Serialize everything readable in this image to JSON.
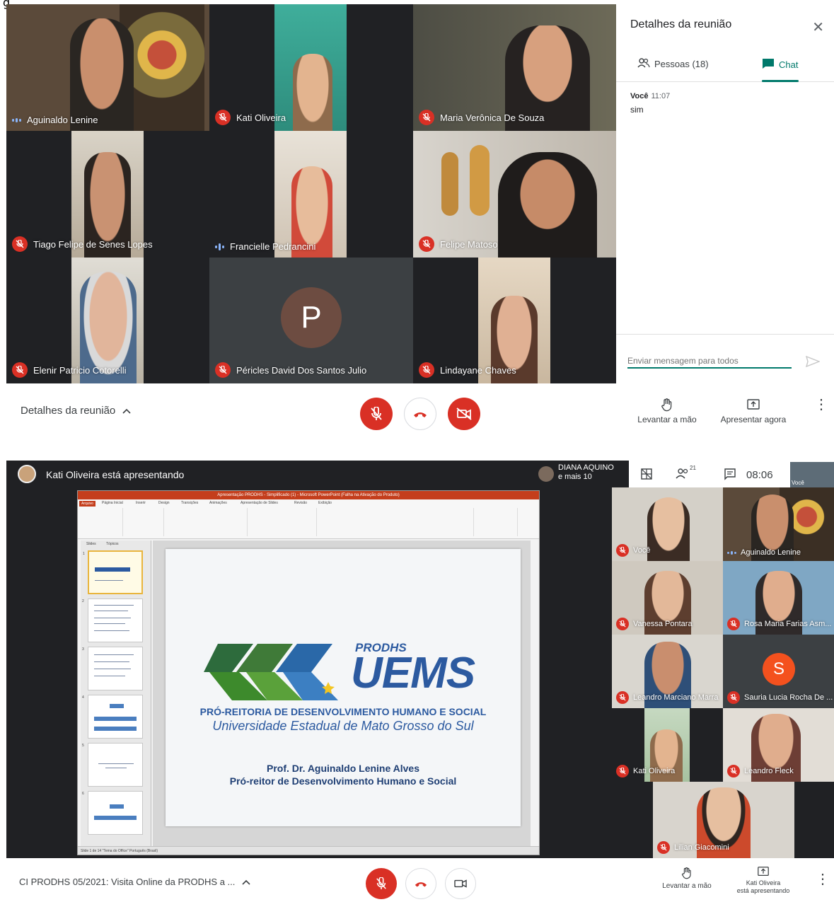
{
  "figure_label": "g",
  "meeting1": {
    "tiles": [
      {
        "name": "Aguinaldo Lenine",
        "status": "speaking"
      },
      {
        "name": "Kati Oliveira",
        "status": "muted"
      },
      {
        "name": "Maria Verônica De Souza",
        "status": "muted"
      },
      {
        "name": "Tiago Felipe de Senes Lopes",
        "status": "muted"
      },
      {
        "name": "Francielle Pedrancini",
        "status": "speaking"
      },
      {
        "name": "Felipe Matoso",
        "status": "muted"
      },
      {
        "name": "Elenir Patricio Cotorelli",
        "status": "muted"
      },
      {
        "name": "Péricles David Dos Santos Julio",
        "status": "muted",
        "avatar_letter": "P"
      },
      {
        "name": "Lindayane Chaves",
        "status": "muted"
      }
    ],
    "panel": {
      "title": "Detalhes da reunião",
      "tab_people": "Pessoas (18)",
      "tab_chat": "Chat",
      "message": {
        "author": "Você",
        "time": "11:07",
        "text": "sim"
      },
      "input_placeholder": "Enviar mensagem para todos"
    },
    "bottom": {
      "details_label": "Detalhes da reunião",
      "raise_hand": "Levantar a mão",
      "present_now": "Apresentar agora"
    },
    "colors": {
      "accent": "#00796b",
      "danger": "#d93025"
    }
  },
  "meeting2": {
    "presenter_text": "Kati Oliveira está apresentando",
    "host": {
      "name": "DIANA AQUINO",
      "others": "e mais 10"
    },
    "people_count": "21",
    "clock": "08:06",
    "self_label": "Você",
    "ppt": {
      "window_title": "Apresentação PRODHS - Simplificado (1) - Microsoft PowerPoint (Falha na Ativação do Produto)",
      "tabs": [
        "Arquivo",
        "Página Inicial",
        "Inserir",
        "Design",
        "Transições",
        "Animações",
        "Apresentação de Slides",
        "Revisão",
        "Exibição"
      ],
      "panel_tabs": [
        "Slides",
        "Tópicos"
      ],
      "status_text": "Slide 1 de 14   \"Tema do Office\"   Português (Brasil)",
      "slide": {
        "prodhs": "PRODHS",
        "uems": "UEMS",
        "pro_reitoria": "PRÓ-REITORIA DE DESENVOLVIMENTO HUMANO E SOCIAL",
        "university": "Universidade Estadual de Mato Grosso do Sul",
        "professor": "Prof. Dr. Aguinaldo Lenine Alves",
        "role": "Pró-reitor de Desenvolvimento Humano e Social"
      }
    },
    "tiles": [
      {
        "name": "Você",
        "status": "muted"
      },
      {
        "name": "Aguinaldo Lenine",
        "status": "speaking"
      },
      {
        "name": "Vanessa Pontara",
        "status": "muted"
      },
      {
        "name": "Rosa Maria Farias Asm...",
        "status": "muted"
      },
      {
        "name": "Leandro Marciano Marra",
        "status": "muted"
      },
      {
        "name": "Sauria Lucia Rocha De ...",
        "status": "muted",
        "avatar_letter": "S"
      },
      {
        "name": "Kati Oliveira",
        "status": "muted"
      },
      {
        "name": "Leandro Fleck",
        "status": "muted"
      },
      {
        "name": "Lilian Giacomini",
        "status": "muted"
      }
    ],
    "bottom": {
      "meeting_title": "CI PRODHS 05/2021: Visita Online da PRODHS a ...",
      "raise_hand": "Levantar a mão",
      "presenting_line1": "Kati Oliveira",
      "presenting_line2": "está apresentando"
    }
  }
}
